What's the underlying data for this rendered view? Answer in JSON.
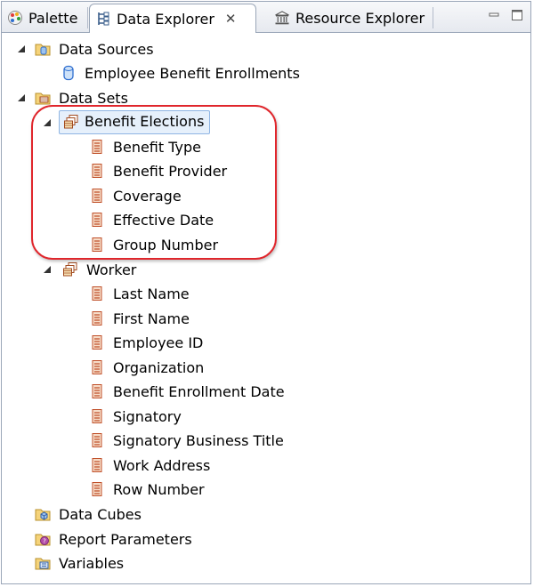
{
  "tabs": {
    "palette": "Palette",
    "data_explorer": "Data Explorer",
    "resource_explorer": "Resource Explorer"
  },
  "tree": {
    "data_sources": {
      "label": "Data Sources",
      "children": [
        "Employee Benefit Enrollments"
      ]
    },
    "data_sets": {
      "label": "Data Sets",
      "sets": [
        {
          "label": "Benefit Elections",
          "fields": [
            "Benefit Type",
            "Benefit Provider",
            "Coverage",
            "Effective Date",
            "Group Number"
          ]
        },
        {
          "label": "Worker",
          "fields": [
            "Last Name",
            "First Name",
            "Employee ID",
            "Organization",
            "Benefit Enrollment Date",
            "Signatory",
            "Signatory Business Title",
            "Work Address",
            "Row Number"
          ]
        }
      ]
    },
    "data_cubes": "Data Cubes",
    "report_parameters": "Report Parameters",
    "variables": "Variables"
  },
  "colors": {
    "highlight": "#e0262c",
    "selection": "#e6f0fb",
    "field_icon": "#c0502a"
  }
}
